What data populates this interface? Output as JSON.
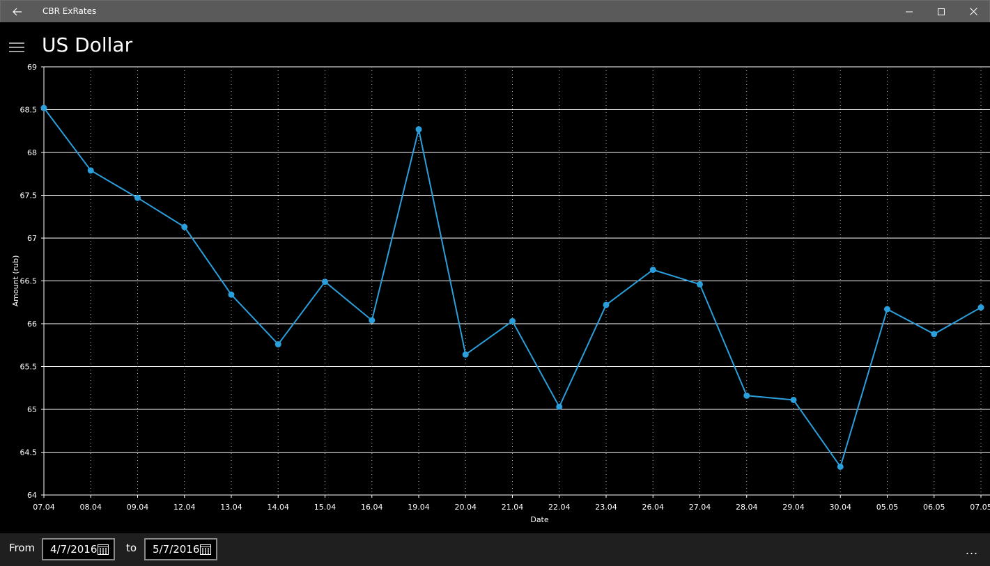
{
  "window": {
    "title": "CBR ExRates"
  },
  "header": {
    "title": "US Dollar"
  },
  "chart_data": {
    "type": "line",
    "xlabel": "Date",
    "ylabel": "Amount (rub)",
    "ylim": [
      64,
      69
    ],
    "yticks": [
      "64",
      "64.5",
      "65",
      "65.5",
      "66",
      "66.5",
      "67",
      "67.5",
      "68",
      "68.5",
      "69"
    ],
    "categories": [
      "07.04",
      "08.04",
      "09.04",
      "12.04",
      "13.04",
      "14.04",
      "15.04",
      "16.04",
      "19.04",
      "20.04",
      "21.04",
      "22.04",
      "23.04",
      "26.04",
      "27.04",
      "28.04",
      "29.04",
      "30.04",
      "05.05",
      "06.05",
      "07.05"
    ],
    "series": [
      {
        "values": [
          68.52,
          67.79,
          67.47,
          67.13,
          66.34,
          65.76,
          66.49,
          66.04,
          68.27,
          65.64,
          66.03,
          65.03,
          66.22,
          66.63,
          66.46,
          65.16,
          65.11,
          64.33,
          66.17,
          65.88,
          66.19
        ]
      }
    ],
    "grid": true,
    "legend": "none",
    "line_color": "#2b9fdc",
    "grid_color": "#ffffff"
  },
  "bottombar": {
    "from_label": "From",
    "from_value": "4/7/2016",
    "to_label": "to",
    "to_value": "5/7/2016",
    "more_label": "..."
  }
}
